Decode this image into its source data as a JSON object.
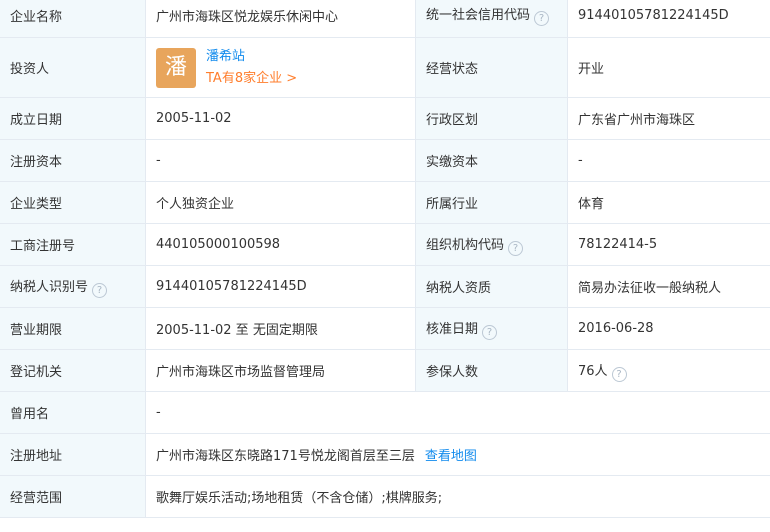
{
  "help_icon": "?",
  "rows": [
    {
      "type": "pair",
      "l1": "企业名称",
      "v1": "广州市海珠区悦龙娱乐休闲中心",
      "l2": "统一社会信用代码",
      "l2_help": true,
      "v2": "91440105781224145D"
    },
    {
      "type": "investor",
      "l1": "投资人",
      "avatar": "潘",
      "name": "潘希站",
      "link": "TA有8家企业 >",
      "l2": "经营状态",
      "v2": "开业"
    },
    {
      "type": "pair",
      "l1": "成立日期",
      "v1": "2005-11-02",
      "l2": "行政区划",
      "v2": "广东省广州市海珠区"
    },
    {
      "type": "pair",
      "l1": "注册资本",
      "v1": "-",
      "l2": "实缴资本",
      "v2": "-"
    },
    {
      "type": "pair",
      "l1": "企业类型",
      "v1": "个人独资企业",
      "l2": "所属行业",
      "v2": "体育"
    },
    {
      "type": "pair",
      "l1": "工商注册号",
      "v1": "440105000100598",
      "l2": "组织机构代码",
      "l2_help": true,
      "v2": "78122414-5"
    },
    {
      "type": "pair",
      "l1": "纳税人识别号",
      "l1_help": true,
      "v1": "91440105781224145D",
      "l2": "纳税人资质",
      "v2": "简易办法征收一般纳税人"
    },
    {
      "type": "pair",
      "l1": "营业期限",
      "v1": "2005-11-02 至 无固定期限",
      "l2": "核准日期",
      "l2_help": true,
      "v2": "2016-06-28"
    },
    {
      "type": "pair",
      "l1": "登记机关",
      "v1": "广州市海珠区市场监督管理局",
      "l2": "参保人数",
      "v2": "76人",
      "v2_help": true
    },
    {
      "type": "full",
      "l1": "曾用名",
      "v1": "-"
    },
    {
      "type": "address",
      "l1": "注册地址",
      "v1": "广州市海珠区东晓路171号悦龙阁首层至三层",
      "link": "查看地图"
    },
    {
      "type": "full",
      "l1": "经营范围",
      "v1": "歌舞厅娱乐活动;场地租赁（不含仓储）;棋牌服务;"
    }
  ]
}
